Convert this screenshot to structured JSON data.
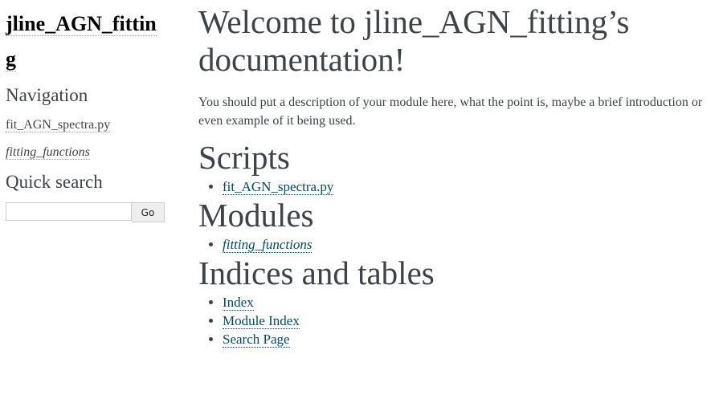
{
  "sidebar": {
    "project_title": "jline_AGN_fitting",
    "navigation_heading": "Navigation",
    "nav_items": [
      {
        "label": "fit_AGN_spectra.py"
      },
      {
        "label": "fitting_functions"
      }
    ],
    "quick_search_heading": "Quick search",
    "search": {
      "value": "",
      "placeholder": "",
      "button_label": "Go"
    }
  },
  "main": {
    "title": "Welcome to jline_AGN_fitting’s documentation!",
    "intro": "You should put a description of your module here, what the point is, maybe a brief introduction or even example of it being used.",
    "sections": [
      {
        "heading": "Scripts",
        "items": [
          {
            "label": "fit_AGN_spectra.py"
          }
        ]
      },
      {
        "heading": "Modules",
        "items": [
          {
            "label": "fitting_functions"
          }
        ]
      },
      {
        "heading": "Indices and tables",
        "items": [
          {
            "label": "Index"
          },
          {
            "label": "Module Index"
          },
          {
            "label": "Search Page"
          }
        ]
      }
    ]
  }
}
